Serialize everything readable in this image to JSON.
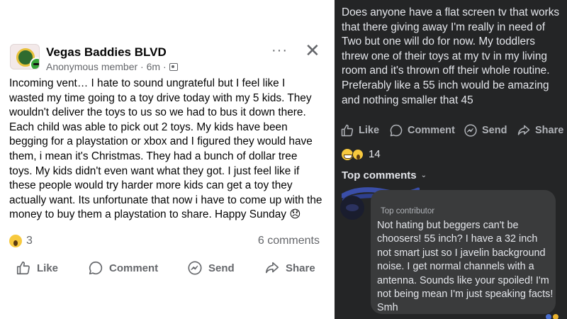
{
  "left_post": {
    "group_name": "Vegas Baddies BLVD",
    "meta": "Anonymous member · 6m ·",
    "more_label": "···",
    "close_label": "✕",
    "body": "Incoming vent… I hate to sound ungrateful but I feel like I wasted my time going to a toy drive today with my 5 kids. They wouldn't deliver the toys to us so we had to bus it down there. Each child was able to pick out 2 toys. My kids have been begging for a playstation or xbox and I figured they would have them, i mean it's Christmas. They had a bunch of dollar tree toys. My kids didn't even want what they got. I just feel like if these people would try harder more kids can get a toy they actually want. Its unfortunate that now i have to come up with the money to buy them a playstation to share. Happy Sunday 😞",
    "reaction_count": "3",
    "comments_count": "6 comments",
    "actions": {
      "like": "Like",
      "comment": "Comment",
      "send": "Send",
      "share": "Share"
    }
  },
  "right_post": {
    "body": "Does anyone have a flat screen tv that works that there giving away I'm really in need of Two but one will do for now. My toddlers threw one of their toys at my tv in my living room and it's thrown off their whole routine. Preferably  like a 55 inch would be amazing and nothing smaller that 45",
    "actions": {
      "like": "Like",
      "comment": "Comment",
      "send": "Send",
      "share": "Share"
    },
    "reaction_count": "14",
    "top_comments_label": "Top comments",
    "comment": {
      "role": "Top contributor",
      "text": "Not hating but beggers can't be choosers! 55 inch? I have a 32 inch not smart just so I javelin background noise. I get normal channels with a antenna. Sounds like your spoiled! I'm not being mean I'm just speaking facts! Smh"
    }
  },
  "colors": {
    "light_bg": "#ffffff",
    "dark_bg": "#242526",
    "bubble_bg": "#3a3b3c",
    "muted_text": "#65676b"
  }
}
